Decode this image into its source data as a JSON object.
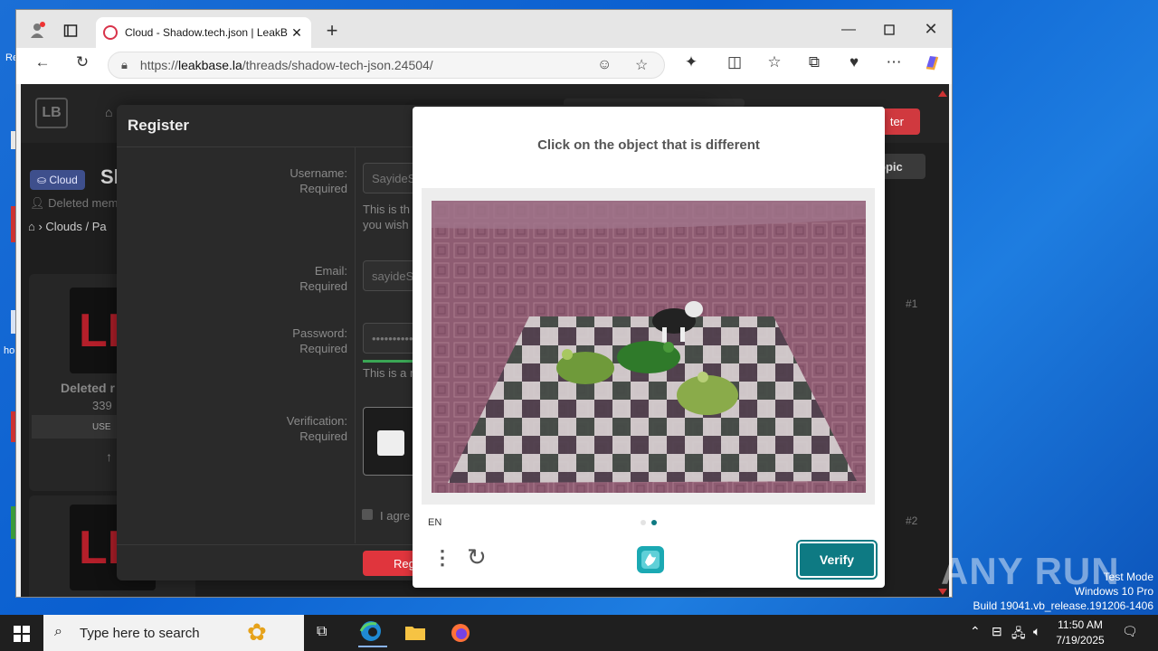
{
  "desktop": {
    "fragments": [
      "Re",
      "ho"
    ]
  },
  "browser": {
    "tab_title": "Cloud - Shadow.tech.json | LeakB",
    "url_prefix": "https://",
    "url_host": "leakbase.la",
    "url_path": "/threads/shadow-tech-json.24504/"
  },
  "site": {
    "header_register": "ter",
    "topic_button": "opic",
    "badge": "Cloud",
    "thread_title_fragment": "Sl",
    "author_fragment": "Deleted mem",
    "breadcrumb": "Clouds / Pa",
    "post_author": "Deleted r",
    "post_count": "339",
    "user_badge": "USE",
    "post_num_1": "#1",
    "post_num_2": "#2",
    "avatar_text": "LE"
  },
  "register": {
    "title": "Register",
    "username_label": "Username:",
    "username_req": "Required",
    "username_value": "SayideS",
    "username_hint_1": "This is th",
    "username_hint_2": "you wish",
    "email_label": "Email:",
    "email_req": "Required",
    "email_value": "sayideS",
    "password_label": "Password:",
    "password_req": "Required",
    "password_value": "••••••••••",
    "password_hint": "This is a re",
    "verification_label": "Verification:",
    "verification_req": "Required",
    "agree_fragment": "I agre",
    "submit_fragment": "Regi"
  },
  "captcha": {
    "prompt": "Click on the object that is different",
    "language": "EN",
    "verify_label": "Verify",
    "page_indicator": {
      "current": 2,
      "total": 2
    }
  },
  "watermark": {
    "brand": "ANY RUN",
    "mode": "Test Mode",
    "os": "Windows 10 Pro",
    "build": "Build 19041.vb_release.191206-1406"
  },
  "taskbar": {
    "search_placeholder": "Type here to search",
    "time": "11:50 AM",
    "date": "7/19/2025"
  },
  "colors": {
    "accent_red": "#d0393f",
    "captcha_teal": "#0e7a83",
    "desktop_blue": "#0a5fd0"
  }
}
